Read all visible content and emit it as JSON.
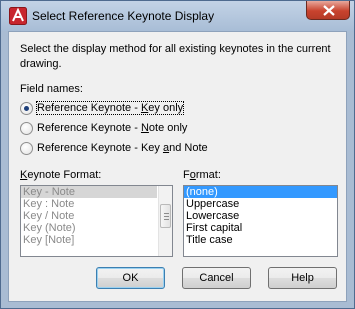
{
  "window": {
    "title": "Select Reference Keynote Display"
  },
  "description": "Select the display method for all existing keynotes in the current drawing.",
  "field_names": {
    "label": "Field names:",
    "options": [
      {
        "pre": "Reference Keynote - ",
        "key": "K",
        "post": "ey only",
        "checked": true
      },
      {
        "pre": "Reference Keynote - ",
        "key": "N",
        "post": "ote only",
        "checked": false
      },
      {
        "pre": "Reference Keynote - Key ",
        "key": "a",
        "post": "nd Note",
        "checked": false
      }
    ]
  },
  "keynote_format": {
    "label_key": "K",
    "label_rest": "eynote Format:",
    "items": [
      "Key - Note",
      "Key : Note",
      "Key / Note",
      "Key (Note)",
      "Key [Note]"
    ],
    "selected": "Key - Note",
    "enabled": false
  },
  "format": {
    "label_pre": "F",
    "label_key": "o",
    "label_rest": "rmat:",
    "items": [
      "(none)",
      "Uppercase",
      "Lowercase",
      "First capital",
      "Title case"
    ],
    "selected": "(none)"
  },
  "buttons": {
    "ok": "OK",
    "cancel": "Cancel",
    "help": "Help"
  }
}
